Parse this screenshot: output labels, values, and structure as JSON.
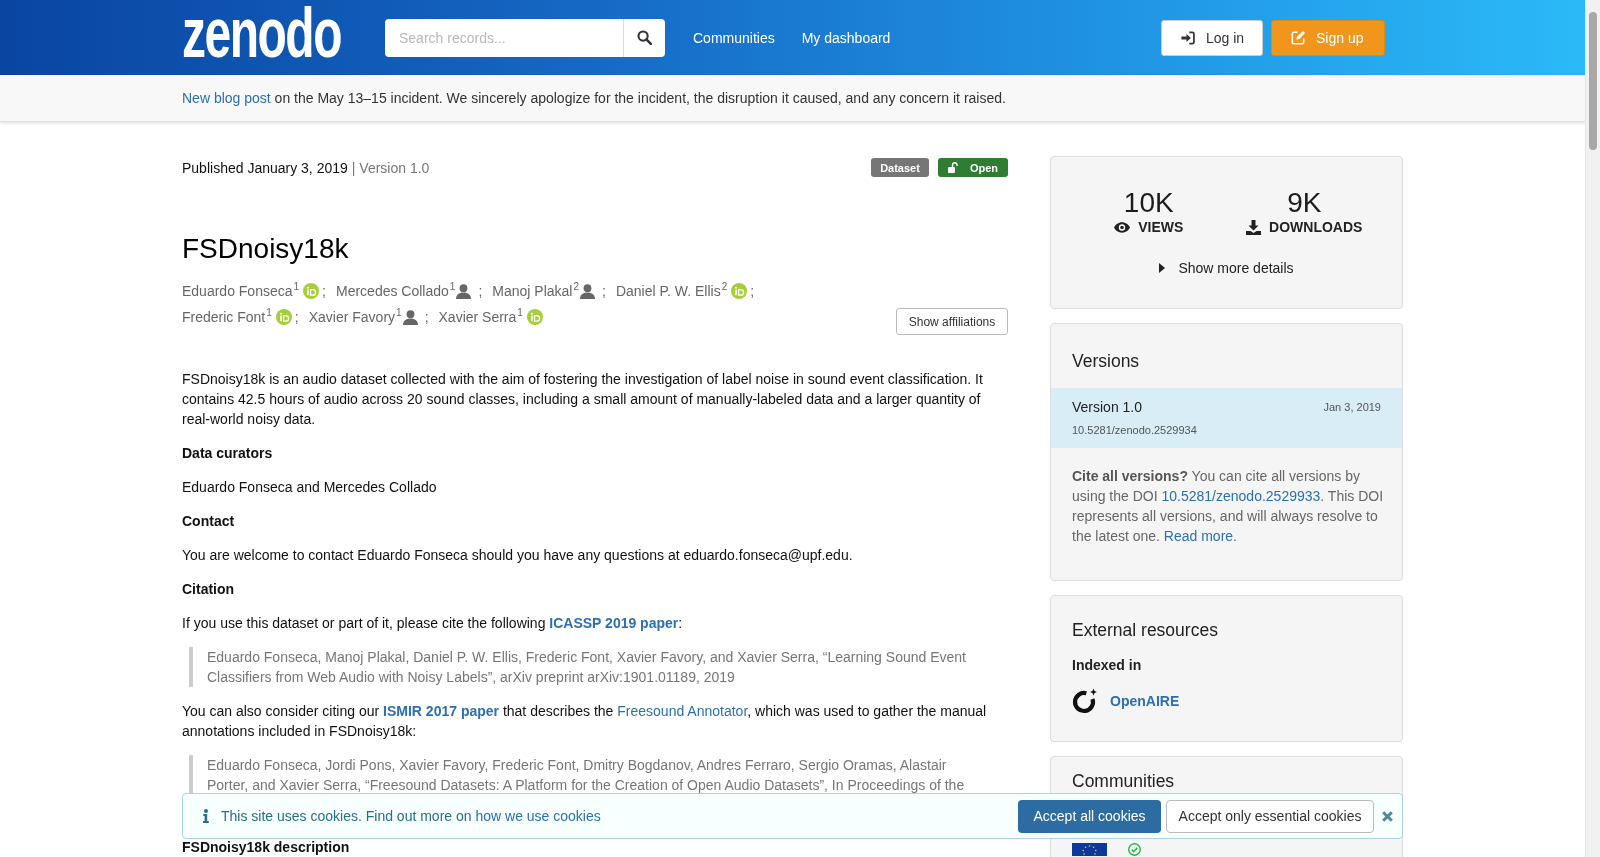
{
  "header": {
    "logo": "zenodo",
    "search": {
      "placeholder": "Search records..."
    },
    "nav": [
      {
        "label": "Communities"
      },
      {
        "label": "My dashboard"
      }
    ],
    "buttons": [
      {
        "label": "Log in",
        "kind": "login"
      },
      {
        "label": "Sign up",
        "kind": "signup"
      }
    ]
  },
  "announcement": {
    "parts": [
      {
        "kind": "link",
        "text": "New blog post"
      },
      {
        "kind": "text",
        "text": " on the May 13–15 incident. We sincerely apologize for the incident, the disruption it caused, and any concern it raised."
      }
    ]
  },
  "record": {
    "published": "Published January 3, 2019",
    "version": "| Version 1.0",
    "badges": [
      {
        "label": "Dataset",
        "kind": "type",
        "color": "#767676"
      },
      {
        "label": "Open",
        "kind": "access",
        "color": "#2e7d32"
      }
    ],
    "title": "FSDnoisy18k",
    "authors": [
      {
        "name": "Eduardo Fonseca$^{1}$",
        "kind": "id",
        "separator": ";"
      },
      {
        "name": "Mercedes Collado$^{1}$",
        "kind": "person",
        "separator": ";"
      },
      {
        "name": "Manoj Plakal$^{2}$",
        "kind": "person",
        "separator": ";"
      },
      {
        "name": "Daniel P. W. Ellis$^{2}$",
        "kind": "id",
        "separator": ";"
      },
      {
        "name": "Frederic Font$^{1}$",
        "kind": "id",
        "separator": ";"
      },
      {
        "name": "Xavier Favory$^{1}$",
        "kind": "person",
        "separator": ";"
      },
      {
        "name": "Xavier Serra$^{1}$",
        "kind": "id"
      }
    ],
    "affiliations_button": "Show affiliations",
    "body": [
      {
        "kind": "paragraph",
        "parts": [
          {
            "kind": "text",
            "text": "FSDnoisy18k is an audio dataset collected with the aim of fostering the investigation of label noise in sound event classification. It contains 42.5 hours of audio across 20 sound classes, including a small amount of manually-labeled data and a larger quantity of real-world noisy data."
          }
        ]
      },
      {
        "kind": "heading",
        "text": "Data curators"
      },
      {
        "kind": "paragraph",
        "parts": [
          {
            "kind": "text",
            "text": "Eduardo Fonseca and Mercedes Collado"
          }
        ]
      },
      {
        "kind": "heading",
        "text": "Contact"
      },
      {
        "kind": "paragraph",
        "parts": [
          {
            "kind": "text",
            "text": "You are welcome to contact Eduardo Fonseca should you have any questions at eduardo.fonseca@upf.edu."
          }
        ]
      },
      {
        "kind": "heading",
        "text": "Citation"
      },
      {
        "kind": "paragraph",
        "parts": [
          {
            "kind": "text",
            "text": "If you use this dataset or part of it, please cite the following "
          },
          {
            "kind": "strong_link",
            "text": "ICASSP 2019 paper"
          },
          {
            "kind": "text",
            "text": ":"
          }
        ]
      },
      {
        "kind": "quote",
        "text": "Eduardo Fonseca, Manoj Plakal, Daniel P. W. Ellis, Frederic Font, Xavier Favory, and Xavier Serra, “Learning Sound Event Classifiers from Web Audio with Noisy Labels”, arXiv preprint arXiv:1901.01189, 2019"
      },
      {
        "kind": "paragraph",
        "parts": [
          {
            "kind": "text",
            "text": "You can also consider citing our "
          },
          {
            "kind": "strong_link",
            "text": "ISMIR 2017 paper"
          },
          {
            "kind": "text",
            "text": " that describes the "
          },
          {
            "kind": "link",
            "text": "Freesound Annotator"
          },
          {
            "kind": "text",
            "text": ", which was used to gather the manual annotations included in FSDnoisy18k:"
          }
        ]
      },
      {
        "kind": "quote",
        "text": "Eduardo Fonseca, Jordi Pons, Xavier Favory, Frederic Font, Dmitry Bogdanov, Andres Ferraro, Sergio Oramas, Alastair Porter, and Xavier Serra, “Freesound Datasets: A Platform for the Creation of Open Audio Datasets”, In Proceedings of the"
      },
      {
        "kind": "heading",
        "text": "FSDnoisy18k description"
      }
    ]
  },
  "sidebar": {
    "stats": [
      {
        "value": "10K",
        "label": "VIEWS",
        "kind": "views"
      },
      {
        "value": "9K",
        "label": "DOWNLOADS",
        "kind": "downloads"
      }
    ],
    "details": {
      "label": "Show more details",
      "expanded": false
    },
    "versions": {
      "title": "Versions",
      "items": [
        {
          "title": "Version 1.0",
          "date": "Jan 3, 2019",
          "doi": "10.5281/zenodo.2529934",
          "selected": true
        }
      ],
      "note": [
        {
          "kind": "strong",
          "text": "Cite all versions?"
        },
        {
          "kind": "text",
          "text": " You can cite all versions by using the DOI "
        },
        {
          "kind": "link",
          "text": "10.5281/zenodo.2529933"
        },
        {
          "kind": "text",
          "text": ". This DOI represents all versions, and will always resolve to the latest one. "
        },
        {
          "kind": "link",
          "text": "Read more"
        },
        {
          "kind": "text",
          "text": "."
        }
      ]
    },
    "external": {
      "title": "External resources",
      "subtitle": "Indexed in",
      "links": [
        {
          "label": "OpenAIRE"
        }
      ]
    },
    "communities": {
      "title": "Communities",
      "items": [
        {
          "verified": true
        }
      ]
    }
  },
  "cookie_banner": {
    "parts": [
      {
        "kind": "text",
        "text": "This site uses cookies. Find out more on "
      },
      {
        "kind": "link",
        "text": "how we use cookies"
      }
    ],
    "buttons": [
      {
        "label": "Accept all cookies",
        "kind": "primary"
      },
      {
        "label": "Accept only essential cookies",
        "kind": "secondary"
      }
    ]
  }
}
